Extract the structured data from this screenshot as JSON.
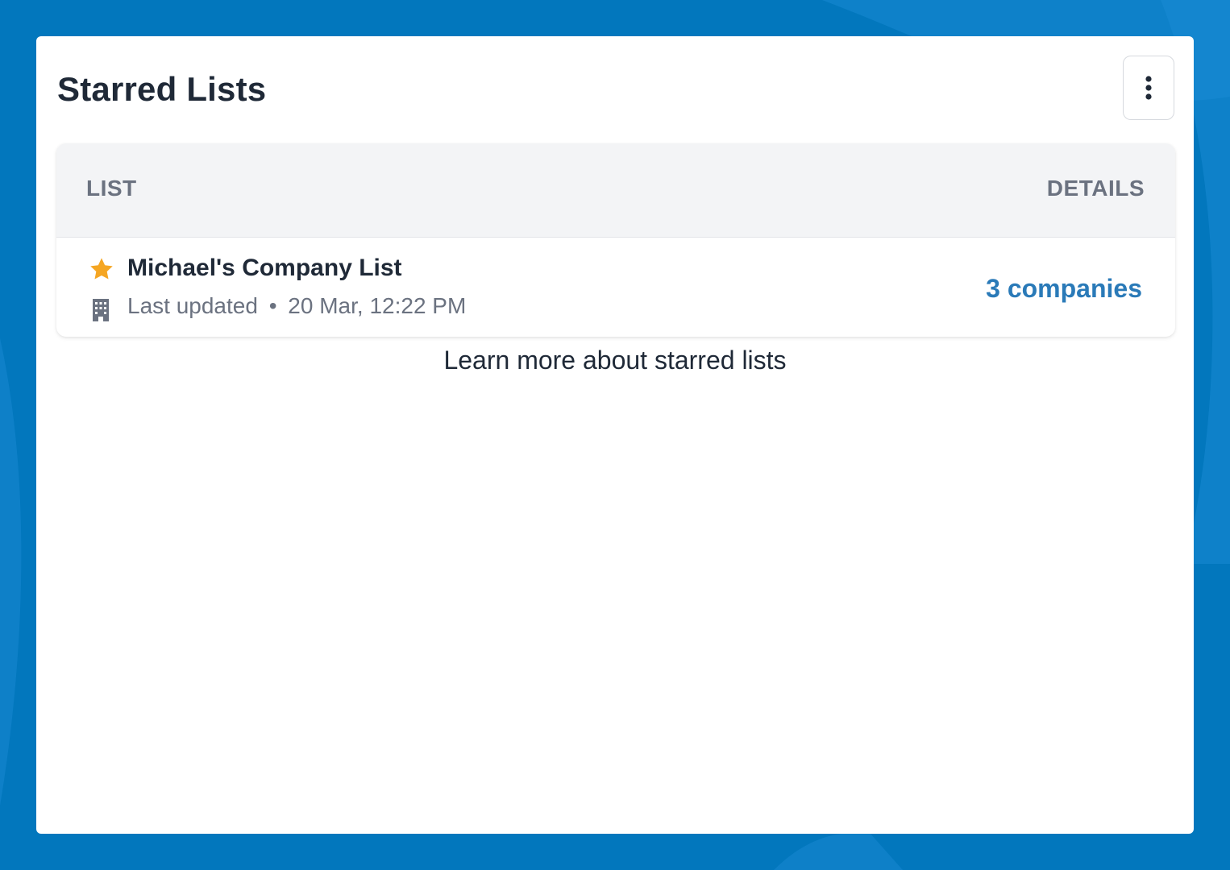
{
  "colors": {
    "background": "#0277bd",
    "accent_link": "#2a7ab8",
    "star": "#f5a623",
    "panel": "#ffffff",
    "header_bg": "#f3f4f6"
  },
  "panel": {
    "title": "Starred Lists",
    "menu_icon": "vertical-ellipsis-icon"
  },
  "table": {
    "columns": {
      "list": "LIST",
      "details": "DETAILS"
    },
    "rows": [
      {
        "name": "Michael's Company List",
        "starred": true,
        "star_icon": "star-icon",
        "type_icon": "building-icon",
        "updated_label": "Last updated",
        "separator": "•",
        "updated_value": "20 Mar, 12:22 PM",
        "details": "3 companies"
      }
    ]
  },
  "footer": {
    "learn_more": "Learn more about starred lists"
  }
}
